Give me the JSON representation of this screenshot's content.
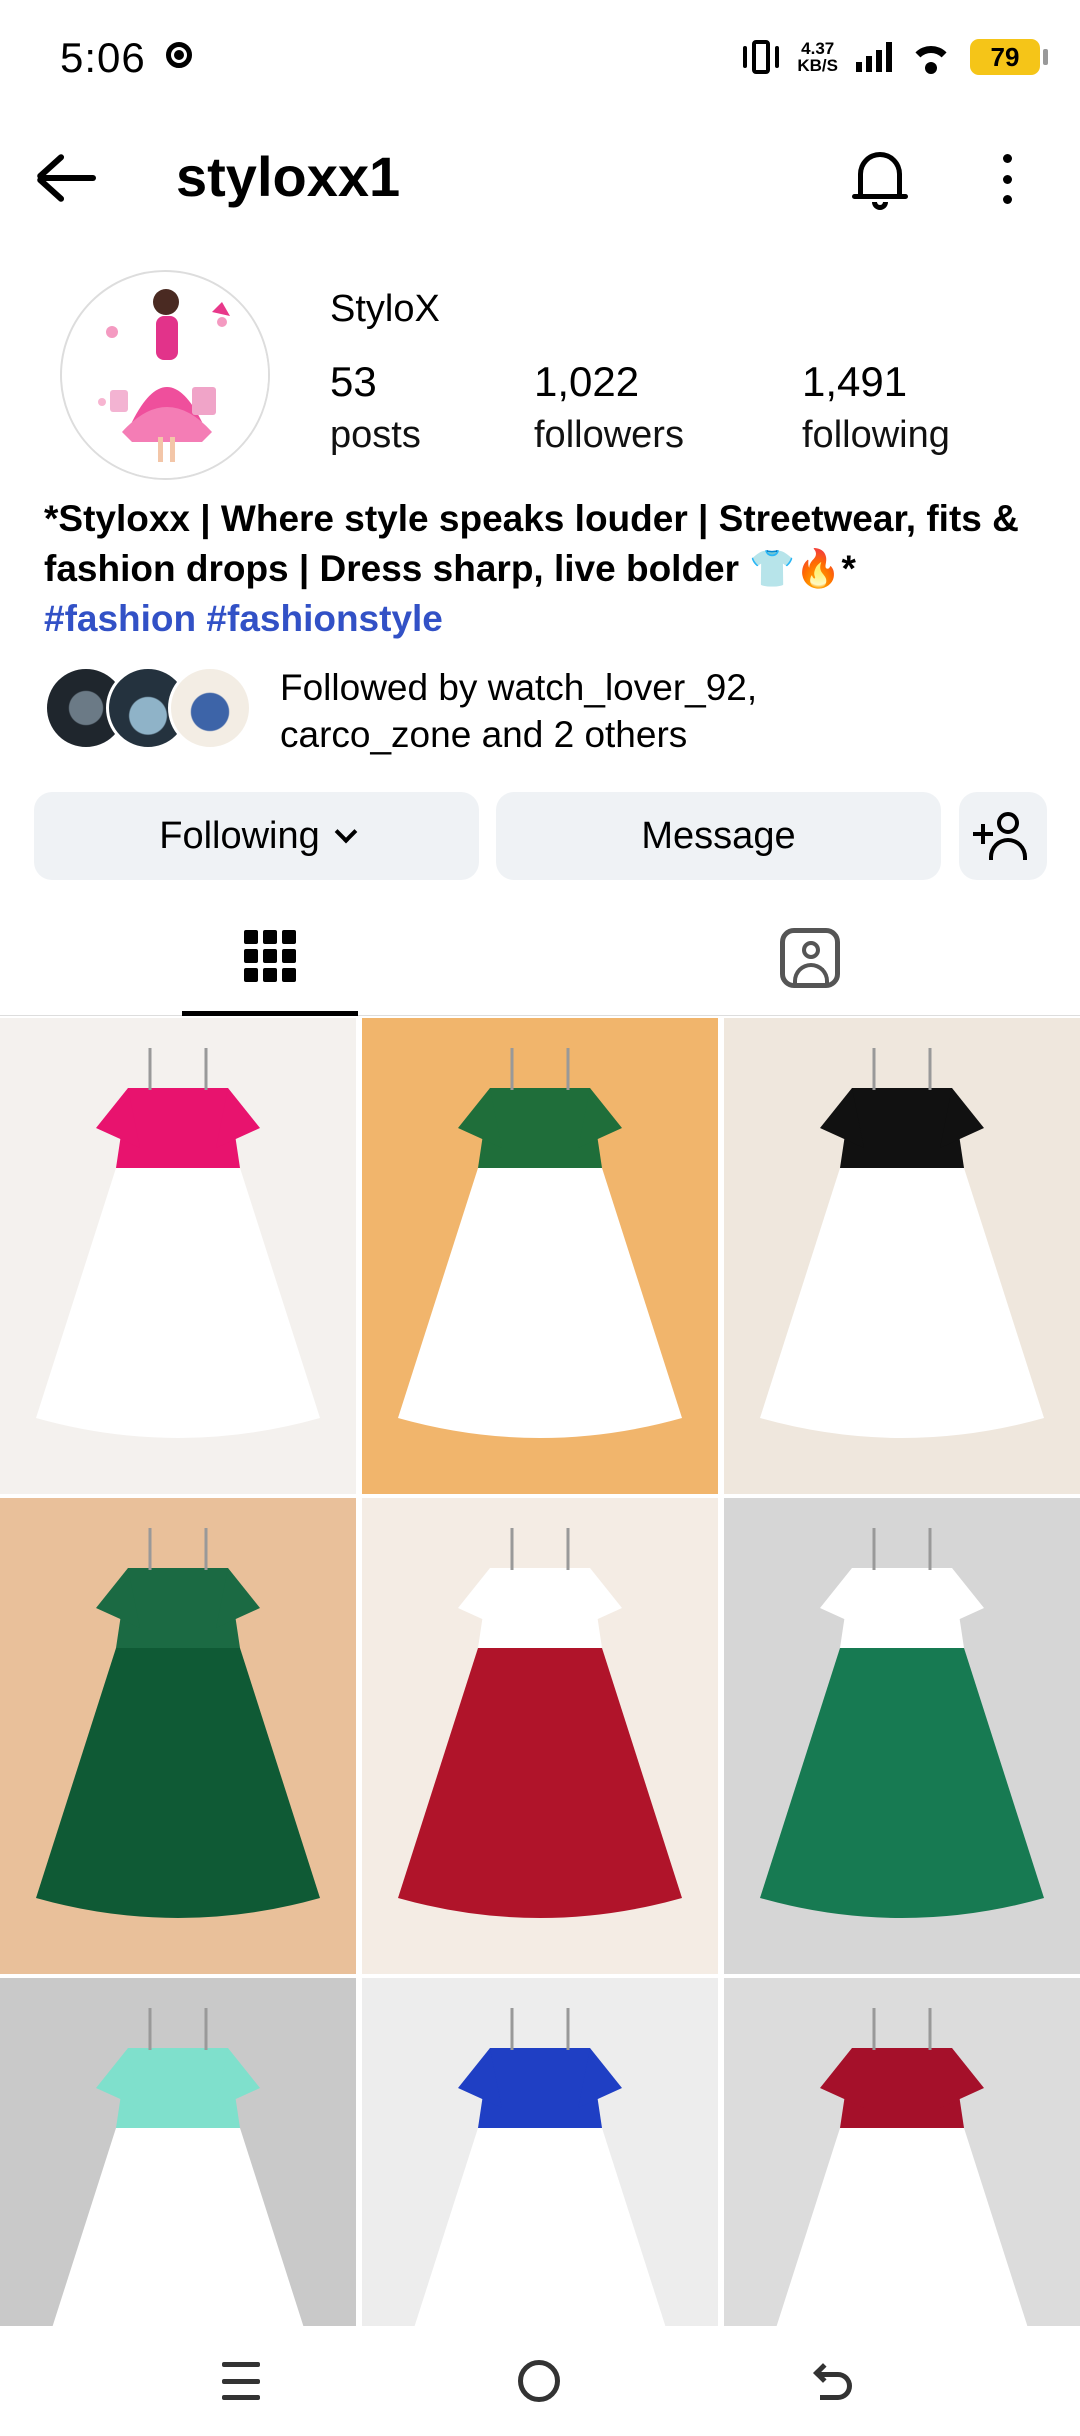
{
  "status_bar": {
    "time": "5:06",
    "net_speed_value": "4.37",
    "net_speed_unit": "KB/S",
    "battery": "79"
  },
  "header": {
    "username": "styloxx1"
  },
  "profile": {
    "display_name": "StyloX",
    "stats": {
      "posts_count": "53",
      "posts_label": "posts",
      "followers_count": "1,022",
      "followers_label": "followers",
      "following_count": "1,491",
      "following_label": "following"
    },
    "bio_text": "*Styloxx | Where style speaks louder | Streetwear, fits & fashion drops | Dress sharp, live bolder 👕🔥*",
    "bio_tags": "#fashion #fashionstyle",
    "followed_by": {
      "prefix": "Followed by ",
      "user1": "watch_lover_92,",
      "user2": "carco_zone",
      "suffix": " and 2 others"
    }
  },
  "actions": {
    "following_label": "Following",
    "message_label": "Message"
  },
  "tabs": [
    {
      "icon": "grid-icon",
      "active": true
    },
    {
      "icon": "tagged-icon",
      "active": false
    }
  ],
  "posts": [
    {
      "icon": "dress-photo",
      "colors": [
        "#f4f1ee",
        "#e8136e",
        "#ffffff"
      ]
    },
    {
      "icon": "dress-photo",
      "colors": [
        "#f1b56c",
        "#1f6e3a",
        "#ffffff"
      ]
    },
    {
      "icon": "dress-photo",
      "colors": [
        "#efe7dd",
        "#111111",
        "#ffffff"
      ]
    },
    {
      "icon": "dress-photo",
      "colors": [
        "#e9c09a",
        "#1b6a43",
        "#0f5a35"
      ]
    },
    {
      "icon": "dress-photo",
      "colors": [
        "#f4ece4",
        "#ffffff",
        "#b0142a"
      ]
    },
    {
      "icon": "dress-photo",
      "colors": [
        "#d6d6d6",
        "#ffffff",
        "#177a52"
      ]
    },
    {
      "icon": "dress-photo",
      "colors": [
        "#c9c9c9",
        "#7fe0cc",
        "#ffffff"
      ]
    },
    {
      "icon": "dress-photo",
      "colors": [
        "#ededed",
        "#1f3fc4",
        "#ffffff"
      ]
    },
    {
      "icon": "dress-photo",
      "colors": [
        "#dcdcdc",
        "#a5102a",
        "#ffffff"
      ]
    }
  ],
  "nav": {
    "menu_icon": "menu-icon",
    "home_icon": "home-icon",
    "back_icon": "back-icon"
  }
}
